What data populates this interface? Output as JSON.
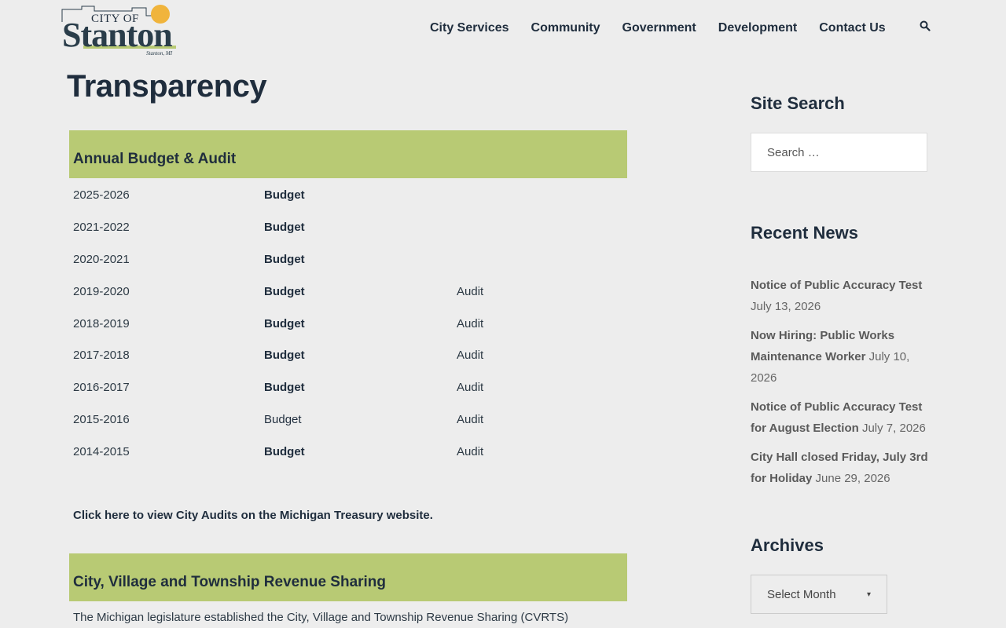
{
  "logo": {
    "city_of": "CITY OF",
    "name": "Stanton",
    "sub": "Stanton, MI"
  },
  "nav": {
    "items": [
      "City Services",
      "Community",
      "Government",
      "Development",
      "Contact Us"
    ],
    "search_icon": "search-icon"
  },
  "page": {
    "title": "Transparency"
  },
  "budget_section": {
    "heading": "Annual Budget & Audit",
    "rows": [
      {
        "year": "2025-2026",
        "budget": "Budget",
        "audit": ""
      },
      {
        "year": "2021-2022",
        "budget": "Budget",
        "audit": ""
      },
      {
        "year": "2020-2021",
        "budget": "Budget",
        "audit": ""
      },
      {
        "year": "2019-2020",
        "budget": "Budget",
        "audit": "Audit"
      },
      {
        "year": "2018-2019",
        "budget": "Budget",
        "audit": "Audit"
      },
      {
        "year": "2017-2018",
        "budget": "Budget",
        "audit": "Audit"
      },
      {
        "year": "2016-2017",
        "budget": "Budget",
        "audit": "Audit"
      },
      {
        "year": "2015-2016",
        "budget": "Budget",
        "audit": "Audit"
      },
      {
        "year": "2014-2015",
        "budget": "Budget",
        "audit": "Audit"
      }
    ],
    "treasury_link": "Click here to view City Audits on the Michigan Treasury website."
  },
  "revenue_section": {
    "heading": "City, Village and Township Revenue Sharing",
    "text": "The Michigan legislature established the City, Village and Township Revenue Sharing (CVRTS)"
  },
  "sidebar": {
    "search_title": "Site Search",
    "search_placeholder": "Search …",
    "news_title": "Recent News",
    "news": [
      {
        "title": "Notice of Public Accuracy Test",
        "date": "July 13, 2026"
      },
      {
        "title": "Now Hiring: Public Works Maintenance Worker",
        "date": "July 10, 2026"
      },
      {
        "title": "Notice of Public Accuracy Test for August Election",
        "date": "July 7, 2026"
      },
      {
        "title": "City Hall closed Friday, July 3rd for Holiday",
        "date": "June 29, 2026"
      }
    ],
    "archives_title": "Archives",
    "archives_select": "Select Month"
  },
  "colors": {
    "band": "#b8ca74",
    "text": "#1f2d3d",
    "background": "#ededed",
    "sun": "#f0b43c"
  }
}
